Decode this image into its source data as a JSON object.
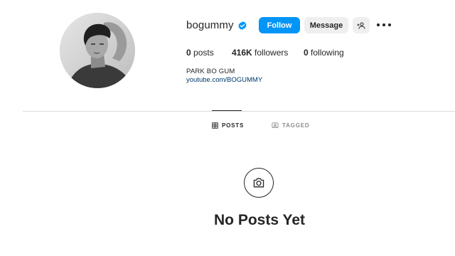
{
  "profile": {
    "username": "bogummy",
    "verified": true,
    "full_name": "PARK BO GUM",
    "link": "youtube.com/BOGUMMY"
  },
  "actions": {
    "follow_label": "Follow",
    "message_label": "Message",
    "suggest_icon": "add-person-icon",
    "more_icon": "more-options-icon"
  },
  "stats": {
    "posts_count": "0",
    "posts_label": "posts",
    "followers_count": "416K",
    "followers_label": "followers",
    "following_count": "0",
    "following_label": "following"
  },
  "tabs": [
    {
      "label": "POSTS",
      "icon": "grid-icon",
      "active": true
    },
    {
      "label": "TAGGED",
      "icon": "tag-icon",
      "active": false
    }
  ],
  "empty_state": {
    "icon": "camera-icon",
    "title": "No Posts Yet"
  },
  "colors": {
    "accent": "#0095f6",
    "verified_badge": "#0095f6",
    "link": "#00376b",
    "secondary_button": "#efefef",
    "divider": "#dbdbdb"
  }
}
